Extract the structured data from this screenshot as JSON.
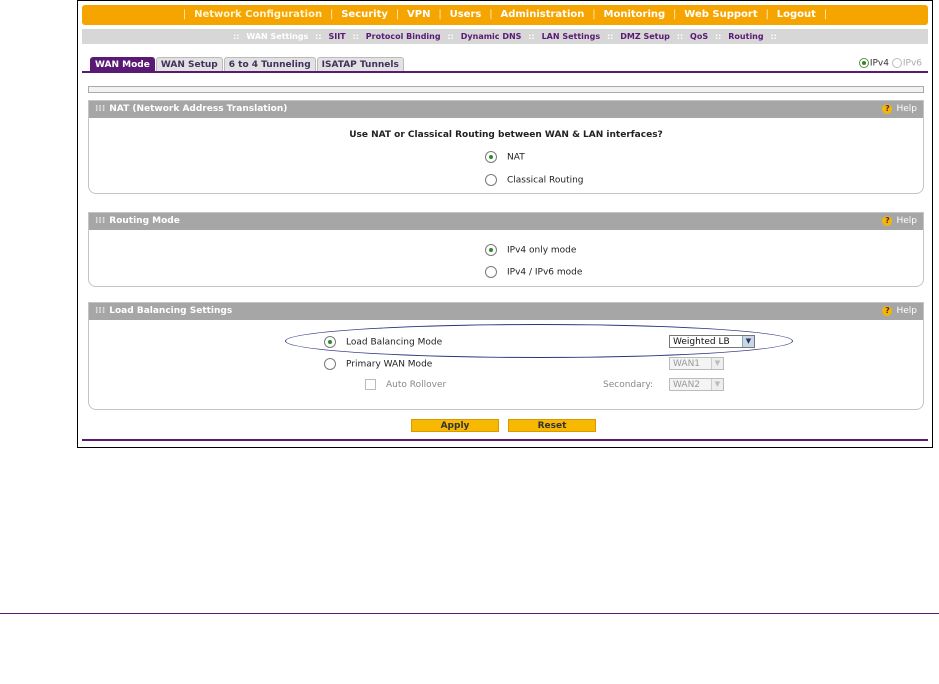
{
  "main_nav": {
    "items": [
      "Network Configuration",
      "Security",
      "VPN",
      "Users",
      "Administration",
      "Monitoring",
      "Web Support",
      "Logout"
    ]
  },
  "sub_nav": {
    "items": [
      "WAN Settings",
      "SIIT",
      "Protocol Binding",
      "Dynamic DNS",
      "LAN Settings",
      "DMZ Setup",
      "QoS",
      "Routing"
    ]
  },
  "tabs": [
    "WAN Mode",
    "WAN Setup",
    "6 to 4 Tunneling",
    "ISATAP Tunnels"
  ],
  "ip_version": {
    "ipv4": "IPv4",
    "ipv6": "IPv6",
    "selected": "IPv4"
  },
  "nat_panel": {
    "title": "NAT (Network Address Translation)",
    "help": "Help",
    "question": "Use NAT or Classical Routing between WAN & LAN interfaces?",
    "options": [
      "NAT",
      "Classical Routing"
    ],
    "selected": "NAT"
  },
  "routing_panel": {
    "title": "Routing Mode",
    "help": "Help",
    "options": [
      "IPv4 only mode",
      "IPv4 / IPv6 mode"
    ],
    "selected": "IPv4 only mode"
  },
  "lb_panel": {
    "title": "Load Balancing Settings",
    "help": "Help",
    "lb_mode_label": "Load Balancing Mode",
    "lb_mode_value": "Weighted LB",
    "primary_label": "Primary WAN Mode",
    "primary_value": "WAN1",
    "auto_rollover_label": "Auto Rollover",
    "secondary_label": "Secondary:",
    "secondary_value": "WAN2"
  },
  "buttons": {
    "apply": "Apply",
    "reset": "Reset"
  },
  "colors": {
    "accent_orange": "#f6a400",
    "brand_purple": "#5a1a74",
    "panel_header": "#a6a6a6"
  }
}
